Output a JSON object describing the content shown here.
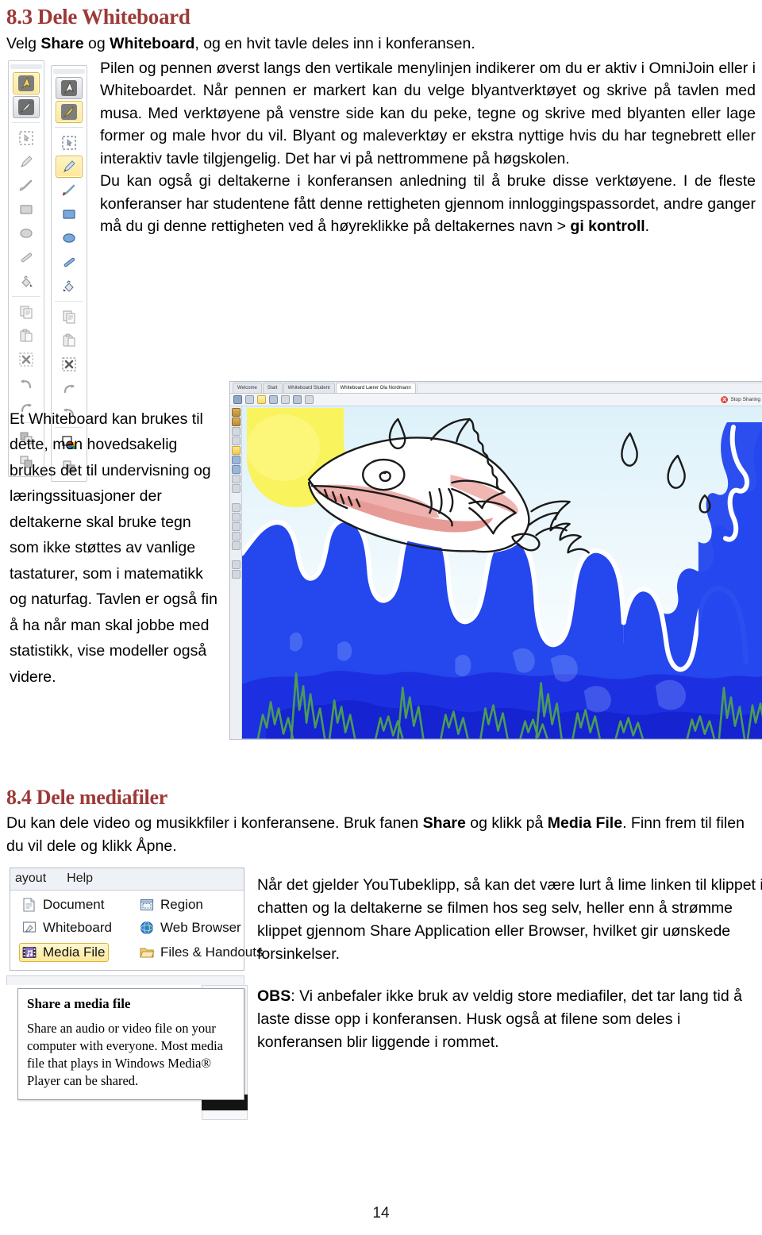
{
  "document": {
    "page_number": "14",
    "heading_color": "#9C3A38"
  },
  "section_83": {
    "heading": "8.3 Dele Whiteboard",
    "intro_before_bold1": "Velg ",
    "intro_bold1": "Share",
    "intro_between": " og ",
    "intro_bold2": "Whiteboard",
    "intro_after": ", og en hvit tavle deles inn i konferansen.",
    "para_wrap": "Pilen og pennen øverst langs den vertikale menylinjen indikerer om du er aktiv i OmniJoin eller i Whiteboardet. Når pennen er markert kan du velge blyantverktøyet og skrive på tavlen med musa. Med verktøyene på venstre side kan du peke, tegne og skrive med blyanten eller lage former og male hvor du vil. Blyant og maleverktøy er ekstra nyttige hvis du har tegnebrett eller interaktiv tavle tilgjengelig. Det har vi på nettrommene på høgskolen.",
    "para_wrap2_a": "Du kan også gi deltakerne i konferansen anledning til å bruke disse verktøyene. I de fleste konferanser har studentene fått denne rettigheten gjennom innloggingspassordet, andre ganger må du gi denne rettigheten ved å høyreklikke på deltakernes navn > ",
    "para_wrap2_bold": "gi kontroll",
    "para_wrap2_end": ".",
    "left_column": "Et Whiteboard kan brukes til dette, men hovedsakelig brukes det til undervisning og læringssituasjoner der deltakerne skal bruke tegn som ikke støttes av vanlige tastaturer, som i matematikk og naturfag. Tavlen er også fin å ha når man skal jobbe med statistikk, vise modeller også videre."
  },
  "toolbars": {
    "left_tools": [
      "arrow-pointer-gold-icon",
      "pen-grey-icon",
      "select-region-icon",
      "pencil-icon",
      "brush-icon",
      "rectangle-icon",
      "ellipse-icon",
      "line-icon",
      "fill-bucket-icon",
      "copy-icon",
      "paste-icon",
      "delete-icon",
      "undo-icon",
      "redo-icon",
      "bring-front-icon",
      "send-back-icon"
    ],
    "right_tools": [
      "arrow-pointer-icon",
      "pen-gold-icon",
      "select-region-icon",
      "pencil-icon",
      "brush-icon",
      "rectangle-icon",
      "ellipse-icon",
      "line-icon",
      "fill-bucket-icon",
      "copy-icon",
      "paste-icon",
      "delete-icon",
      "redo-icon",
      "undo-icon",
      "color-palette-icon",
      "send-back-icon"
    ]
  },
  "whiteboard_screenshot": {
    "tabs": [
      {
        "label": "Welcome",
        "active": false
      },
      {
        "label": "Start",
        "active": false
      },
      {
        "label": "Whiteboard Student",
        "active": false
      },
      {
        "label": "Whiteboard Lærer Ola Nordmann",
        "active": true
      }
    ],
    "stop_sharing_label": "Stop Sharing",
    "stop_sharing_icon": "stop-sharing-icon",
    "drawing_title": "fish-drawing",
    "drawing_colors": {
      "sky": "#eaf6fb",
      "sun": "#f7ef5a",
      "water": "#2447ee",
      "water_dark": "#1b2ddf",
      "wave_outline": "#ffffff",
      "fish_mouth": "#e79b96",
      "seaweed": "#4a9c54",
      "ink": "#1a1a1a"
    }
  },
  "section_84": {
    "heading": "8.4 Dele mediafiler",
    "intro_a": "Du kan dele video og musikkfiler i konferansene. Bruk fanen ",
    "intro_bold1": "Share",
    "intro_b": " og klikk på ",
    "intro_bold2": "Media File",
    "intro_c": ". Finn frem til filen du vil dele og klikk Åpne.",
    "right_para_1": "Når det gjelder YouTubeklipp, så kan det være lurt å lime linken til klippet i chatten og la deltakerne se filmen hos seg selv, heller enn å strømme klippet gjennom Share Application eller Browser, hvilket gir uønskede forsinkelser.",
    "right_para_2_bold": "OBS",
    "right_para_2": ": Vi anbefaler ikke bruk av veldig store mediafiler, det tar lang tid å laste disse opp i konferansen. Husk også at filene som deles i konferansen blir liggende i rommet."
  },
  "share_menu": {
    "menubar": [
      {
        "label": "ayout",
        "icon": "layout-menu"
      },
      {
        "label": "Help",
        "icon": "help-menu"
      }
    ],
    "items": [
      {
        "label": "Document",
        "icon": "document-icon",
        "highlight": false
      },
      {
        "label": "Region",
        "icon": "region-icon",
        "highlight": false
      },
      {
        "label": "Whiteboard",
        "icon": "whiteboard-icon",
        "highlight": false
      },
      {
        "label": "Web Browser",
        "icon": "globe-icon",
        "highlight": false
      },
      {
        "label": "Media File",
        "icon": "media-file-icon",
        "highlight": true
      },
      {
        "label": "Files & Handouts",
        "icon": "folder-icon",
        "highlight": false
      }
    ],
    "tooltip": {
      "title": "Share a media file",
      "body": "Share an audio or video file on your computer with everyone. Most media file that plays in Windows Media® Player can be shared."
    }
  }
}
